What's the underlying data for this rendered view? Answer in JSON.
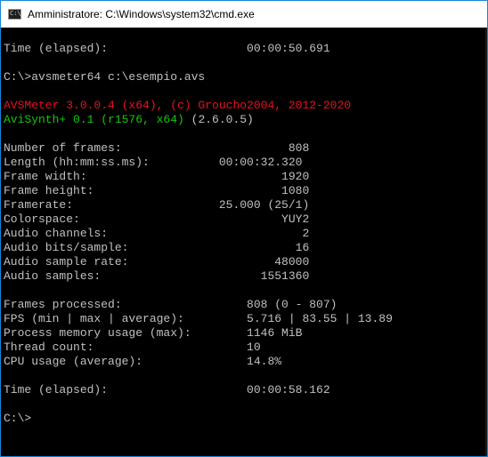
{
  "window": {
    "title": "Amministratore: C:\\Windows\\system32\\cmd.exe",
    "icon_name": "cmd-icon",
    "icon_glyph": "C:\\"
  },
  "console": {
    "lines": [
      "",
      "Time (elapsed):                    00:00:50.691",
      "",
      "C:\\>avsmeter64 c:\\esempio.avs",
      "",
      "AVSMeter 3.0.0.4 (x64), (c) Groucho2004, 2012-2020",
      "AviSynth+ 0.1 (r1576, x64)",
      "",
      "Number of frames:                        808",
      "Length (hh:mm:ss.ms):          00:00:32.320",
      "Frame width:                            1920",
      "Frame height:                           1080",
      "Framerate:                     25.000 (25/1)",
      "Colorspace:                             YUY2",
      "Audio channels:                            2",
      "Audio bits/sample:                        16",
      "Audio sample rate:                     48000",
      "Audio samples:                       1551360",
      "",
      "Frames processed:                  808 (0 - 807)",
      "FPS (min | max | average):         5.716 | 83.55 | 13.89",
      "Process memory usage (max):        1146 MiB",
      "Thread count:                      10",
      "CPU usage (average):               14.8%",
      "",
      "Time (elapsed):                    00:00:58.162",
      "",
      "C:\\>"
    ],
    "avisynth_version_suffix": " (2.6.0.5)"
  },
  "colors": {
    "console_bg": "#000000",
    "console_text": "#c0c0c0",
    "error_red": "#e81123",
    "ok_green": "#16c60c"
  }
}
